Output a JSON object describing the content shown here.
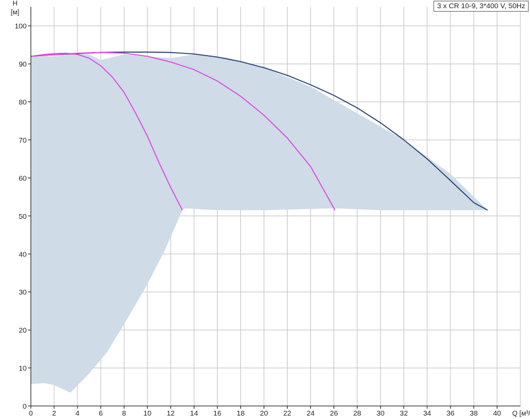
{
  "chart_data": {
    "type": "line",
    "title": "",
    "legend_text": "3 x CR 10-9, 3*400 V, 50Hz",
    "xlabel": "Q [м³/ч]",
    "ylabel": "H",
    "yunit": "[м]",
    "xlim": [
      0,
      42
    ],
    "ylim": [
      0,
      105
    ],
    "grid": true,
    "x_ticks": [
      0,
      2,
      4,
      6,
      8,
      10,
      12,
      14,
      16,
      18,
      20,
      22,
      24,
      26,
      28,
      30,
      32,
      34,
      36,
      38,
      40
    ],
    "y_ticks": [
      0,
      10,
      20,
      30,
      40,
      50,
      60,
      70,
      80,
      90,
      100
    ],
    "operating_range": {
      "fill_color": "#cfdbe6",
      "boundary": [
        [
          0,
          92
        ],
        [
          2,
          92
        ],
        [
          3.5,
          92.5
        ],
        [
          5,
          92.5
        ],
        [
          6,
          91
        ],
        [
          8,
          92.5
        ],
        [
          10,
          92
        ],
        [
          12,
          91.5
        ],
        [
          14,
          92.5
        ],
        [
          17,
          91.5
        ],
        [
          20,
          89
        ],
        [
          24,
          84
        ],
        [
          28,
          77
        ],
        [
          32,
          70
        ],
        [
          36,
          61
        ],
        [
          39.2,
          51.5
        ],
        [
          30,
          51.5
        ],
        [
          26.1,
          52
        ],
        [
          20,
          51.5
        ],
        [
          16,
          51.5
        ],
        [
          13.2,
          52
        ],
        [
          13,
          51.5
        ],
        [
          11.5,
          41
        ],
        [
          10,
          32
        ],
        [
          8,
          21.5
        ],
        [
          6.5,
          14
        ],
        [
          5,
          8.5
        ],
        [
          3.4,
          3.5
        ],
        [
          2,
          5.5
        ],
        [
          1.2,
          6
        ],
        [
          0,
          5.8
        ]
      ]
    },
    "series": [
      {
        "color": "#1f3a6e",
        "x": [
          0,
          2,
          4,
          6,
          8,
          10,
          12,
          14,
          16,
          18,
          20,
          22,
          24,
          26,
          28,
          30,
          32,
          34,
          36,
          38,
          39.2
        ],
        "y": [
          92,
          92.4,
          92.7,
          93,
          93.1,
          93.1,
          93,
          92.6,
          91.8,
          90.6,
          89,
          87,
          84.5,
          81.7,
          78.4,
          74.5,
          70,
          65,
          59.3,
          53.5,
          51.5
        ]
      },
      {
        "color": "#e23de2",
        "x": [
          0,
          1,
          2,
          3,
          4,
          5,
          6,
          7,
          8,
          9,
          10,
          11,
          12,
          13
        ],
        "y": [
          92,
          92.4,
          92.7,
          92.8,
          92.5,
          91.5,
          89.5,
          86.5,
          82.5,
          77,
          71,
          64,
          57.5,
          51.5
        ]
      },
      {
        "color": "#e23de2",
        "x": [
          0,
          2,
          4,
          6,
          8,
          10,
          12,
          14,
          16,
          18,
          20,
          22,
          24,
          26.1
        ],
        "y": [
          92,
          92.4,
          92.8,
          93,
          92.8,
          92,
          90.5,
          88.5,
          85.5,
          81.5,
          76.5,
          70.5,
          63,
          51.5
        ]
      }
    ]
  }
}
